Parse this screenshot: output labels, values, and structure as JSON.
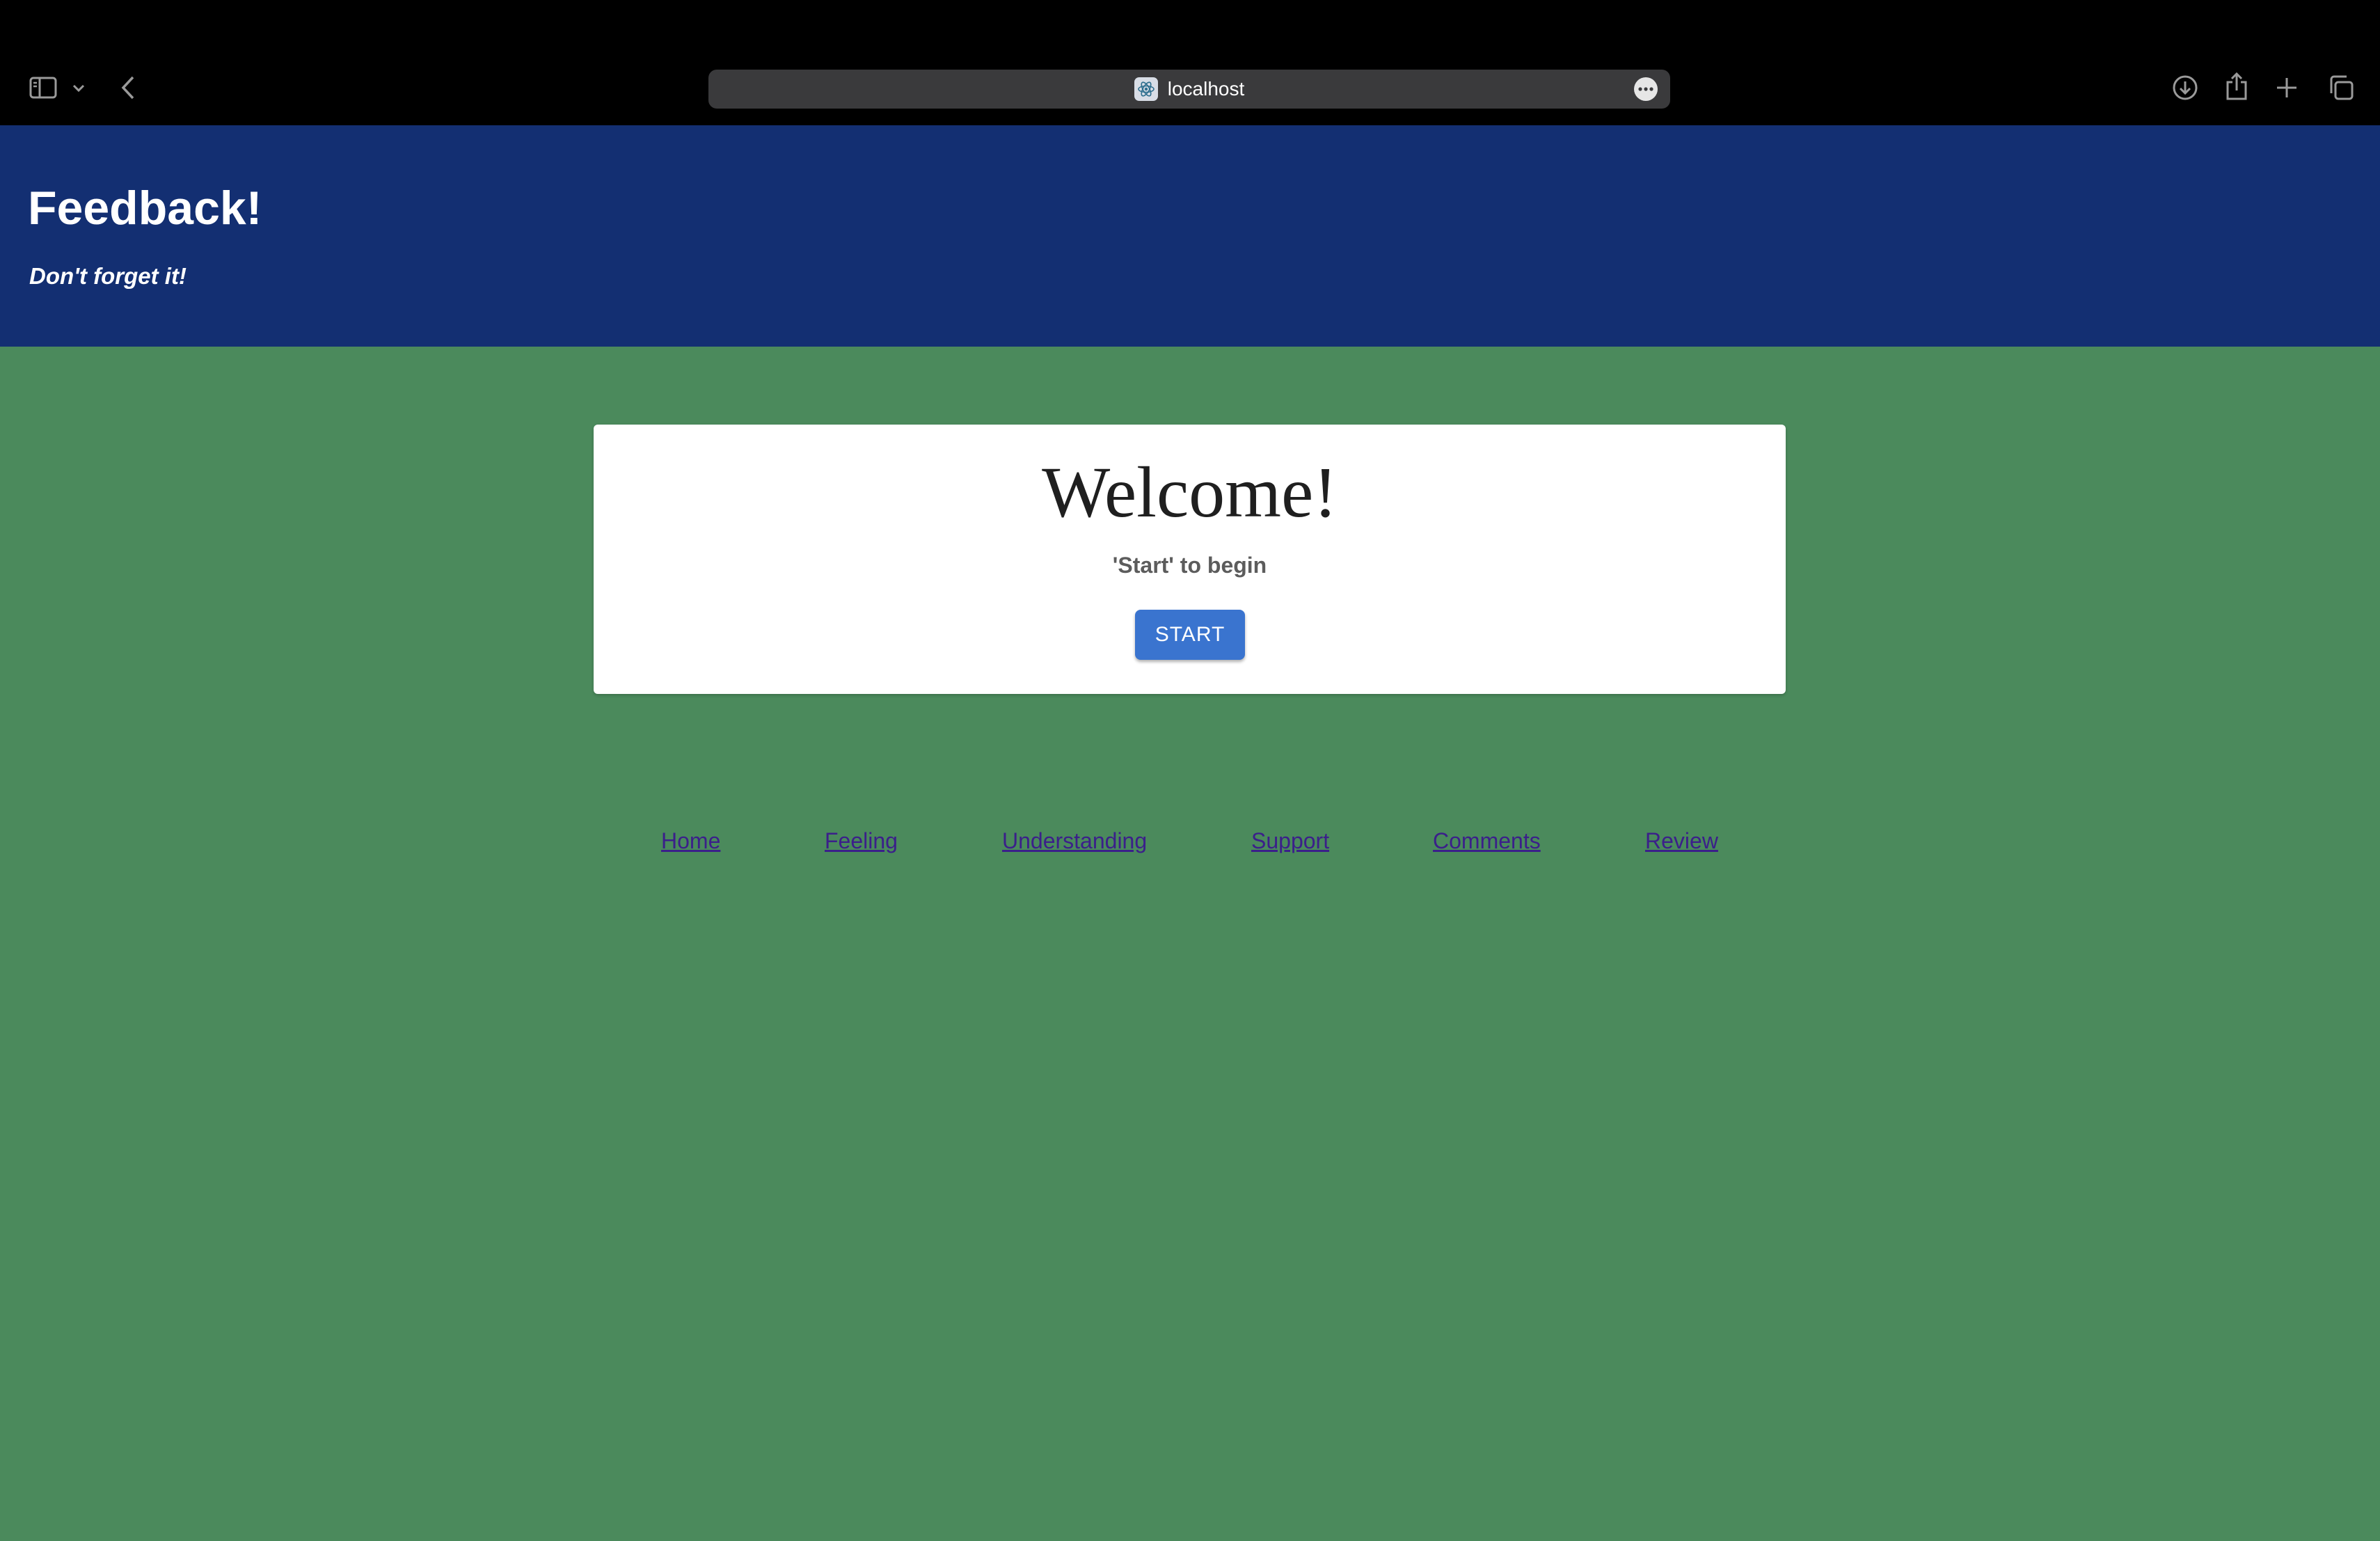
{
  "browser": {
    "address": "localhost",
    "icons": {
      "sidebar": "sidebar-icon",
      "chevron": "chevron-down-icon",
      "back": "back-arrow-icon",
      "favicon": "react-logo-icon",
      "page_menu": "more-icon",
      "download": "download-icon",
      "share": "share-icon",
      "new_tab": "plus-icon",
      "tabs": "tabs-overview-icon"
    }
  },
  "header": {
    "title": "Feedback!",
    "tagline": "Don't forget it!",
    "background": "#132f72"
  },
  "card": {
    "title": "Welcome!",
    "subtitle": "'Start' to begin",
    "button_label": "START",
    "button_color": "#3a74cf"
  },
  "nav": {
    "links": [
      "Home",
      "Feeling",
      "Understanding",
      "Support",
      "Comments",
      "Review"
    ],
    "link_color": "#3b1f8a"
  },
  "page": {
    "background": "#4b8a5c"
  }
}
